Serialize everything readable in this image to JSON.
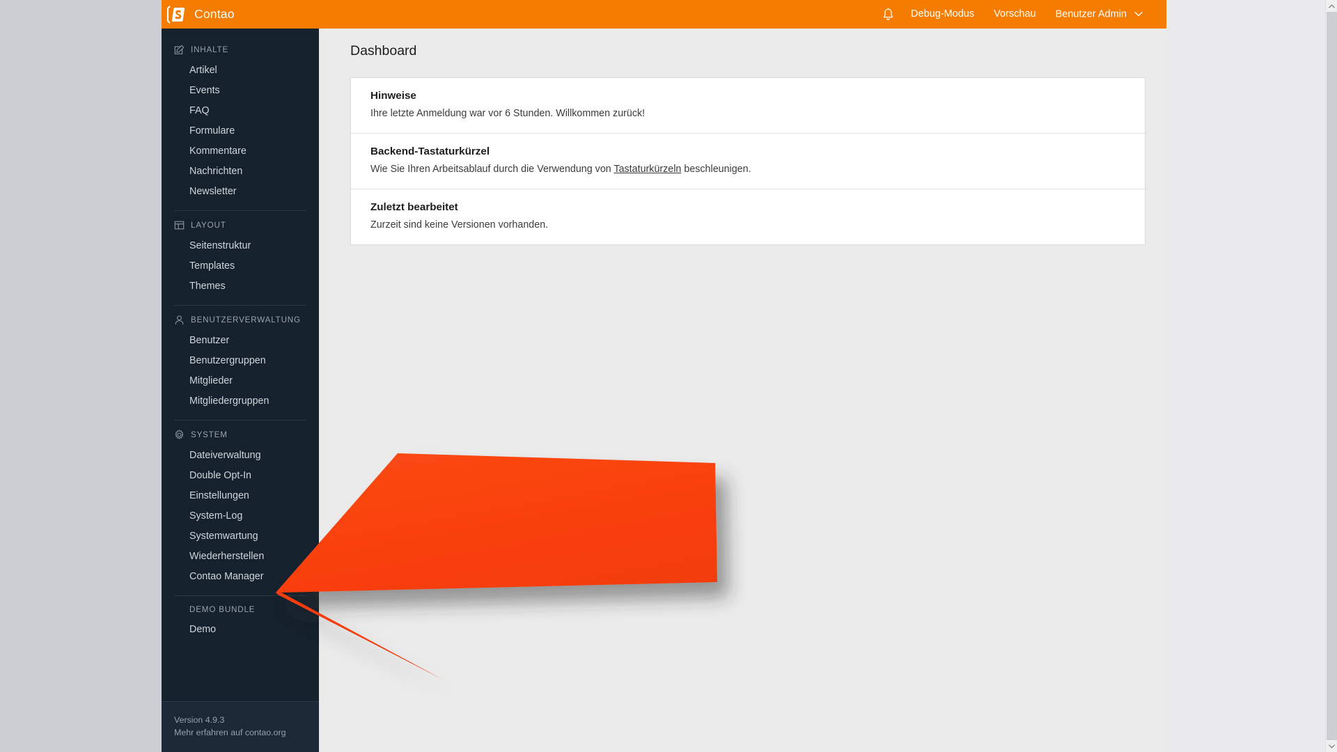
{
  "header": {
    "brand": "Contao",
    "brand_icon": "contao-logo-icon",
    "bell_icon": "notification-bell-icon",
    "items": [
      {
        "label": "Debug-Modus",
        "name": "debug-mode-link"
      },
      {
        "label": "Vorschau",
        "name": "preview-link"
      },
      {
        "label": "Benutzer Admin",
        "name": "user-menu",
        "chevron": "chevron-down-icon"
      }
    ],
    "background_color": "#f47c00"
  },
  "sidebar": {
    "background_color": "#15212d",
    "groups": [
      {
        "title": "INHALTE",
        "icon": "edit-square-icon",
        "items": [
          "Artikel",
          "Events",
          "FAQ",
          "Formulare",
          "Kommentare",
          "Nachrichten",
          "Newsletter"
        ]
      },
      {
        "title": "LAYOUT",
        "icon": "layout-columns-icon",
        "items": [
          "Seitenstruktur",
          "Templates",
          "Themes"
        ]
      },
      {
        "title": "BENUTZERVERWALTUNG",
        "icon": "user-icon",
        "items": [
          "Benutzer",
          "Benutzergruppen",
          "Mitglieder",
          "Mitgliedergruppen"
        ]
      },
      {
        "title": "SYSTEM",
        "icon": "gear-icon",
        "items": [
          "Dateiverwaltung",
          "Double Opt-In",
          "Einstellungen",
          "System-Log",
          "Systemwartung",
          "Wiederherstellen",
          "Contao Manager"
        ]
      },
      {
        "title": "DEMO BUNDLE",
        "icon": "",
        "items": [
          "Demo"
        ]
      }
    ],
    "footer": {
      "version": "Version 4.9.3",
      "more": "Mehr erfahren auf contao.org"
    }
  },
  "main": {
    "page_title": "Dashboard",
    "panels": [
      {
        "title": "Hinweise",
        "text": "Ihre letzte Anmeldung war vor 6 Stunden. Willkommen zurück!",
        "link_text": "",
        "text_after": ""
      },
      {
        "title": "Backend-Tastaturkürzel",
        "text": "Wie Sie Ihren Arbeitsablauf durch die Verwendung von ",
        "link_text": "Tastaturkürzeln",
        "text_after": " beschleunigen."
      },
      {
        "title": "Zuletzt bearbeitet",
        "text": "Zurzeit sind keine Versionen vorhanden.",
        "link_text": "",
        "text_after": ""
      }
    ]
  },
  "overlay": {
    "arrow": {
      "name": "annotation-arrow-left",
      "color": "#f93f0d",
      "direction": "left",
      "points_at": "sidebar"
    }
  },
  "scrollbar": {
    "up_icon": "chevron-up-icon",
    "down_icon": "chevron-down-icon",
    "thumb": "scrollbar-thumb"
  }
}
